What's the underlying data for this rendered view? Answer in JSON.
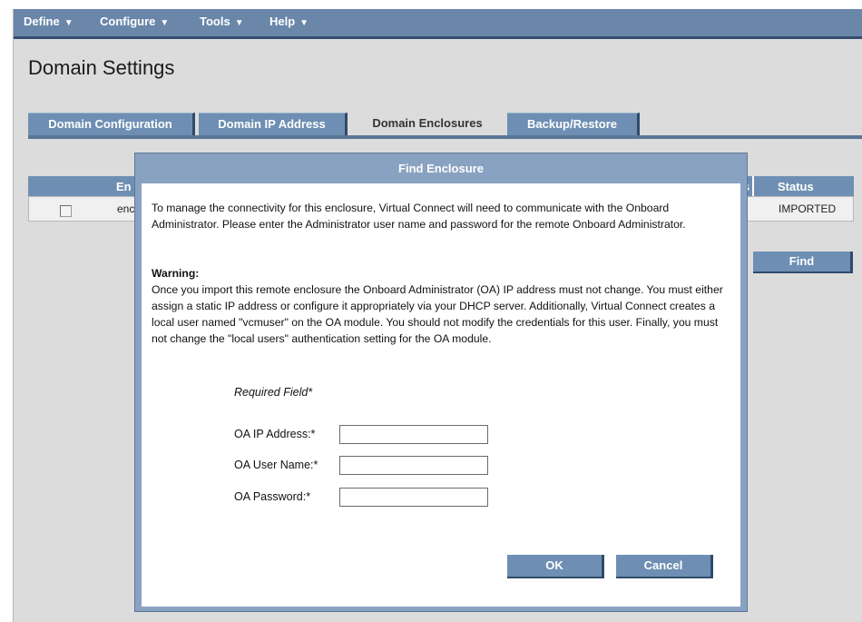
{
  "menu": {
    "items": [
      {
        "label": "Define"
      },
      {
        "label": "Configure"
      },
      {
        "label": "Tools"
      },
      {
        "label": "Help"
      }
    ],
    "caret": "▼"
  },
  "page": {
    "title": "Domain Settings"
  },
  "tabs": [
    {
      "label": "Domain Configuration"
    },
    {
      "label": "Domain IP Address"
    },
    {
      "label": "Domain Enclosures"
    },
    {
      "label": "Backup/Restore"
    }
  ],
  "background_table": {
    "header_visible_left": "En",
    "header_visible_right": "s",
    "status_header": "Status",
    "row_visible_left": "enc",
    "row_status": "IMPORTED"
  },
  "find_button": "Find",
  "dialog": {
    "title": "Find Enclosure",
    "intro": "To manage the connectivity for this enclosure, Virtual Connect will need to communicate with the Onboard Administrator. Please enter the Administrator user name and password for the remote Onboard Administrator.",
    "warning_title": "Warning:",
    "warning_text": "Once you import this remote enclosure the Onboard Administrator (OA) IP address must not change. You must either assign a static IP address or configure it appropriately via your DHCP server. Additionally, Virtual Connect creates a local user named \"vcmuser\" on the OA module. You should not modify the credentials for this user. Finally, you must not change the \"local users\" authentication setting for the OA module.",
    "required_note": "Required Field*",
    "fields": {
      "ip_label": "OA IP Address:*",
      "ip_value": "",
      "user_label": "OA User Name:*",
      "user_value": "",
      "password_label": "OA Password:*",
      "password_value": ""
    },
    "ok_label": "OK",
    "cancel_label": "Cancel"
  }
}
